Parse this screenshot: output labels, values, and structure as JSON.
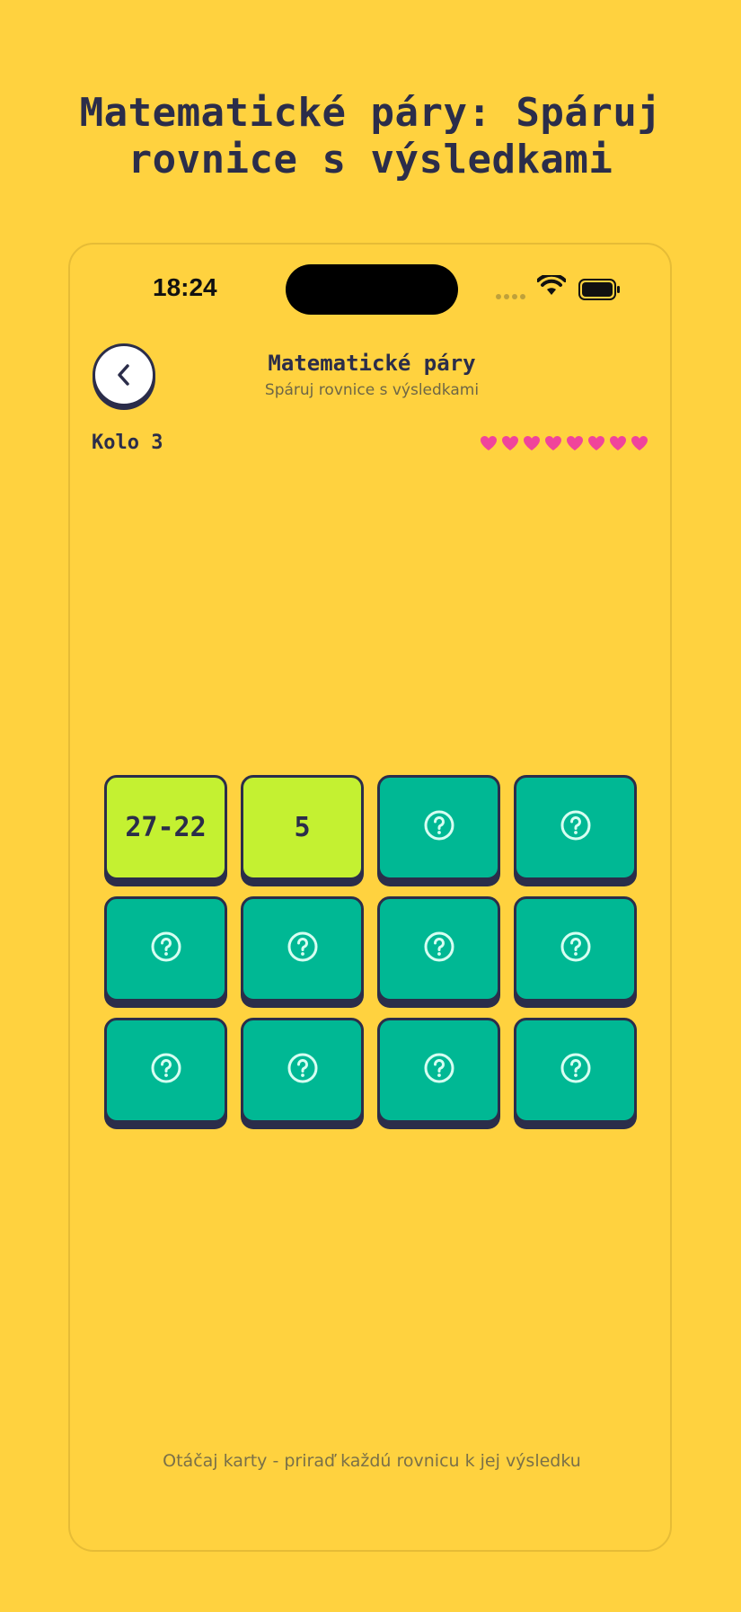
{
  "page": {
    "title_line1": "Matematické páry: Spáruj",
    "title_line2": "rovnice s výsledkami"
  },
  "status_bar": {
    "time": "18:24",
    "icons": [
      "signal-icon",
      "wifi-icon",
      "battery-icon"
    ]
  },
  "header": {
    "back_icon": "chevron-left-icon",
    "title": "Matematické páry",
    "subtitle": "Spáruj rovnice s výsledkami"
  },
  "game": {
    "round_label": "Kolo 3",
    "lives": 8,
    "cards": [
      {
        "state": "revealed",
        "text": "27-22"
      },
      {
        "state": "revealed",
        "text": "5"
      },
      {
        "state": "hidden",
        "icon": "question-icon"
      },
      {
        "state": "hidden",
        "icon": "question-icon"
      },
      {
        "state": "hidden",
        "icon": "question-icon"
      },
      {
        "state": "hidden",
        "icon": "question-icon"
      },
      {
        "state": "hidden",
        "icon": "question-icon"
      },
      {
        "state": "hidden",
        "icon": "question-icon"
      },
      {
        "state": "hidden",
        "icon": "question-icon"
      },
      {
        "state": "hidden",
        "icon": "question-icon"
      },
      {
        "state": "hidden",
        "icon": "question-icon"
      },
      {
        "state": "hidden",
        "icon": "question-icon"
      }
    ]
  },
  "footer": {
    "hint": "Otáčaj karty - priraď každú rovnicu k jej výsledku"
  },
  "colors": {
    "background": "#FFD23F",
    "card_hidden": "#00B894",
    "card_revealed": "#C4F131",
    "outline": "#2B2D4A",
    "heart": "#F0449B"
  }
}
